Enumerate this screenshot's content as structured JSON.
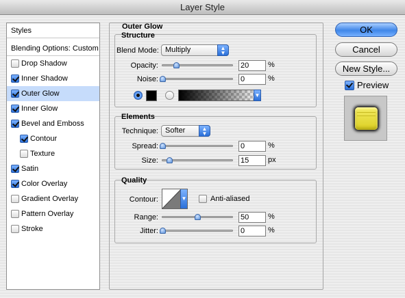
{
  "window": {
    "title": "Layer Style"
  },
  "styles_list": {
    "header": "Styles",
    "items": [
      {
        "label": "Blending Options: Custom",
        "checked": null,
        "selected": false
      },
      {
        "label": "Drop Shadow",
        "checked": false,
        "selected": false
      },
      {
        "label": "Inner Shadow",
        "checked": true,
        "selected": false
      },
      {
        "label": "Outer Glow",
        "checked": true,
        "selected": true
      },
      {
        "label": "Inner Glow",
        "checked": true,
        "selected": false
      },
      {
        "label": "Bevel and Emboss",
        "checked": true,
        "selected": false
      },
      {
        "label": "Contour",
        "checked": true,
        "selected": false
      },
      {
        "label": "Texture",
        "checked": false,
        "selected": false
      },
      {
        "label": "Satin",
        "checked": true,
        "selected": false
      },
      {
        "label": "Color Overlay",
        "checked": true,
        "selected": false
      },
      {
        "label": "Gradient Overlay",
        "checked": false,
        "selected": false
      },
      {
        "label": "Pattern Overlay",
        "checked": false,
        "selected": false
      },
      {
        "label": "Stroke",
        "checked": false,
        "selected": false
      }
    ]
  },
  "outer_glow": {
    "title": "Outer Glow",
    "structure": {
      "title": "Structure",
      "blend_mode_label": "Blend Mode:",
      "blend_mode_value": "Multiply",
      "opacity_label": "Opacity:",
      "opacity_value": "20",
      "opacity_unit": "%",
      "opacity_slider": 0.2,
      "noise_label": "Noise:",
      "noise_value": "0",
      "noise_unit": "%",
      "noise_slider": 0,
      "color_swatch": "#000000"
    },
    "elements": {
      "title": "Elements",
      "technique_label": "Technique:",
      "technique_value": "Softer",
      "spread_label": "Spread:",
      "spread_value": "0",
      "spread_unit": "%",
      "spread_slider": 0,
      "size_label": "Size:",
      "size_value": "15",
      "size_unit": "px",
      "size_slider": 0.1
    },
    "quality": {
      "title": "Quality",
      "contour_label": "Contour:",
      "anti_aliased_label": "Anti-aliased",
      "anti_aliased": false,
      "range_label": "Range:",
      "range_value": "50",
      "range_unit": "%",
      "range_slider": 0.5,
      "jitter_label": "Jitter:",
      "jitter_value": "0",
      "jitter_unit": "%",
      "jitter_slider": 0
    }
  },
  "buttons": {
    "ok": "OK",
    "cancel": "Cancel",
    "new_style": "New Style..."
  },
  "preview": {
    "label": "Preview",
    "checked": true
  }
}
